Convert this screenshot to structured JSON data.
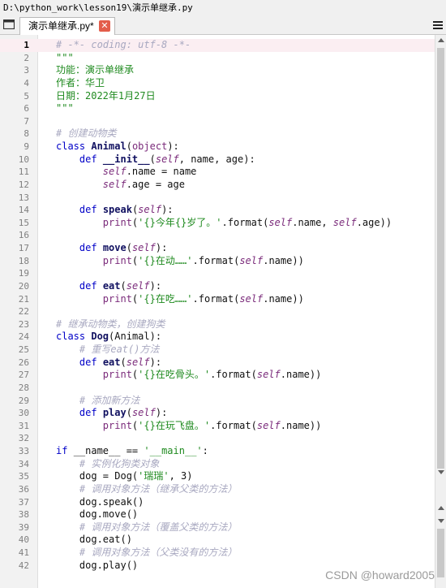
{
  "window": {
    "path": "D:\\python_work\\lesson19\\演示单继承.py"
  },
  "tab": {
    "label": "演示单继承.py*",
    "close_glyph": "✕"
  },
  "watermark": "CSDN @howard2005",
  "lines": [
    {
      "n": "1",
      "t": [
        [
          "c",
          "# -*- coding: utf-8 -*-"
        ]
      ]
    },
    {
      "n": "2",
      "t": [
        [
          "s",
          "\"\"\""
        ]
      ]
    },
    {
      "n": "3",
      "t": [
        [
          "s",
          "功能：演示单继承"
        ]
      ]
    },
    {
      "n": "4",
      "t": [
        [
          "s",
          "作者：华卫"
        ]
      ]
    },
    {
      "n": "5",
      "t": [
        [
          "s",
          "日期：2022年1月27日"
        ]
      ]
    },
    {
      "n": "6",
      "t": [
        [
          "s",
          "\"\"\""
        ]
      ]
    },
    {
      "n": "7",
      "t": []
    },
    {
      "n": "8",
      "t": [
        [
          "c",
          "# 创建动物类"
        ]
      ]
    },
    {
      "n": "9",
      "t": [
        [
          "k",
          "class "
        ],
        [
          "b",
          "Animal"
        ],
        [
          "n",
          "("
        ],
        [
          "bi",
          "object"
        ],
        [
          "n",
          "):"
        ]
      ]
    },
    {
      "n": "10",
      "t": [
        [
          "n",
          "    "
        ],
        [
          "k",
          "def "
        ],
        [
          "b",
          "__init__"
        ],
        [
          "n",
          "("
        ],
        [
          "self",
          "self"
        ],
        [
          "n",
          ", name, age):"
        ]
      ]
    },
    {
      "n": "11",
      "t": [
        [
          "n",
          "        "
        ],
        [
          "self",
          "self"
        ],
        [
          "n",
          ".name = name"
        ]
      ]
    },
    {
      "n": "12",
      "t": [
        [
          "n",
          "        "
        ],
        [
          "self",
          "self"
        ],
        [
          "n",
          ".age = age"
        ]
      ]
    },
    {
      "n": "13",
      "t": []
    },
    {
      "n": "14",
      "t": [
        [
          "n",
          "    "
        ],
        [
          "k",
          "def "
        ],
        [
          "b",
          "speak"
        ],
        [
          "n",
          "("
        ],
        [
          "self",
          "self"
        ],
        [
          "n",
          "):"
        ]
      ]
    },
    {
      "n": "15",
      "t": [
        [
          "n",
          "        "
        ],
        [
          "bi",
          "print"
        ],
        [
          "n",
          "("
        ],
        [
          "s",
          "'{}今年{}岁了。'"
        ],
        [
          "n",
          ".format("
        ],
        [
          "self",
          "self"
        ],
        [
          "n",
          ".name, "
        ],
        [
          "self",
          "self"
        ],
        [
          "n",
          ".age))"
        ]
      ]
    },
    {
      "n": "16",
      "t": []
    },
    {
      "n": "17",
      "t": [
        [
          "n",
          "    "
        ],
        [
          "k",
          "def "
        ],
        [
          "b",
          "move"
        ],
        [
          "n",
          "("
        ],
        [
          "self",
          "self"
        ],
        [
          "n",
          "):"
        ]
      ]
    },
    {
      "n": "18",
      "t": [
        [
          "n",
          "        "
        ],
        [
          "bi",
          "print"
        ],
        [
          "n",
          "("
        ],
        [
          "s",
          "'{}在动……'"
        ],
        [
          "n",
          ".format("
        ],
        [
          "self",
          "self"
        ],
        [
          "n",
          ".name))"
        ]
      ]
    },
    {
      "n": "19",
      "t": []
    },
    {
      "n": "20",
      "t": [
        [
          "n",
          "    "
        ],
        [
          "k",
          "def "
        ],
        [
          "b",
          "eat"
        ],
        [
          "n",
          "("
        ],
        [
          "self",
          "self"
        ],
        [
          "n",
          "):"
        ]
      ]
    },
    {
      "n": "21",
      "t": [
        [
          "n",
          "        "
        ],
        [
          "bi",
          "print"
        ],
        [
          "n",
          "("
        ],
        [
          "s",
          "'{}在吃……'"
        ],
        [
          "n",
          ".format("
        ],
        [
          "self",
          "self"
        ],
        [
          "n",
          ".name))"
        ]
      ]
    },
    {
      "n": "22",
      "t": []
    },
    {
      "n": "23",
      "t": [
        [
          "c",
          "# 继承动物类，创建狗类"
        ]
      ]
    },
    {
      "n": "24",
      "t": [
        [
          "k",
          "class "
        ],
        [
          "b",
          "Dog"
        ],
        [
          "n",
          "(Animal):"
        ]
      ]
    },
    {
      "n": "25",
      "t": [
        [
          "n",
          "    "
        ],
        [
          "c",
          "# 重写eat()方法"
        ]
      ]
    },
    {
      "n": "26",
      "t": [
        [
          "n",
          "    "
        ],
        [
          "k",
          "def "
        ],
        [
          "b",
          "eat"
        ],
        [
          "n",
          "("
        ],
        [
          "self",
          "self"
        ],
        [
          "n",
          "):"
        ]
      ]
    },
    {
      "n": "27",
      "t": [
        [
          "n",
          "        "
        ],
        [
          "bi",
          "print"
        ],
        [
          "n",
          "("
        ],
        [
          "s",
          "'{}在吃骨头。'"
        ],
        [
          "n",
          ".format("
        ],
        [
          "self",
          "self"
        ],
        [
          "n",
          ".name))"
        ]
      ]
    },
    {
      "n": "28",
      "t": []
    },
    {
      "n": "29",
      "t": [
        [
          "n",
          "    "
        ],
        [
          "c",
          "# 添加新方法"
        ]
      ]
    },
    {
      "n": "30",
      "t": [
        [
          "n",
          "    "
        ],
        [
          "k",
          "def "
        ],
        [
          "b",
          "play"
        ],
        [
          "n",
          "("
        ],
        [
          "self",
          "self"
        ],
        [
          "n",
          "):"
        ]
      ]
    },
    {
      "n": "31",
      "t": [
        [
          "n",
          "        "
        ],
        [
          "bi",
          "print"
        ],
        [
          "n",
          "("
        ],
        [
          "s",
          "'{}在玩飞盘。'"
        ],
        [
          "n",
          ".format("
        ],
        [
          "self",
          "self"
        ],
        [
          "n",
          ".name))"
        ]
      ]
    },
    {
      "n": "32",
      "t": []
    },
    {
      "n": "33",
      "t": [
        [
          "k",
          "if "
        ],
        [
          "n",
          "__name__ == "
        ],
        [
          "s",
          "'__main__'"
        ],
        [
          "n",
          ":"
        ]
      ]
    },
    {
      "n": "34",
      "t": [
        [
          "n",
          "    "
        ],
        [
          "c",
          "# 实例化狗类对象"
        ]
      ]
    },
    {
      "n": "35",
      "t": [
        [
          "n",
          "    dog = Dog("
        ],
        [
          "s",
          "'瑞瑞'"
        ],
        [
          "n",
          ", 3)"
        ]
      ]
    },
    {
      "n": "36",
      "t": [
        [
          "n",
          "    "
        ],
        [
          "c",
          "# 调用对象方法（继承父类的方法）"
        ]
      ]
    },
    {
      "n": "37",
      "t": [
        [
          "n",
          "    dog.speak()"
        ]
      ]
    },
    {
      "n": "38",
      "t": [
        [
          "n",
          "    dog.move()"
        ]
      ]
    },
    {
      "n": "39",
      "t": [
        [
          "n",
          "    "
        ],
        [
          "c",
          "# 调用对象方法（覆盖父类的方法）"
        ]
      ]
    },
    {
      "n": "40",
      "t": [
        [
          "n",
          "    dog.eat()"
        ]
      ]
    },
    {
      "n": "41",
      "t": [
        [
          "n",
          "    "
        ],
        [
          "c",
          "# 调用对象方法（父类没有的方法）"
        ]
      ]
    },
    {
      "n": "42",
      "t": [
        [
          "n",
          "    dog.play()"
        ]
      ]
    }
  ]
}
